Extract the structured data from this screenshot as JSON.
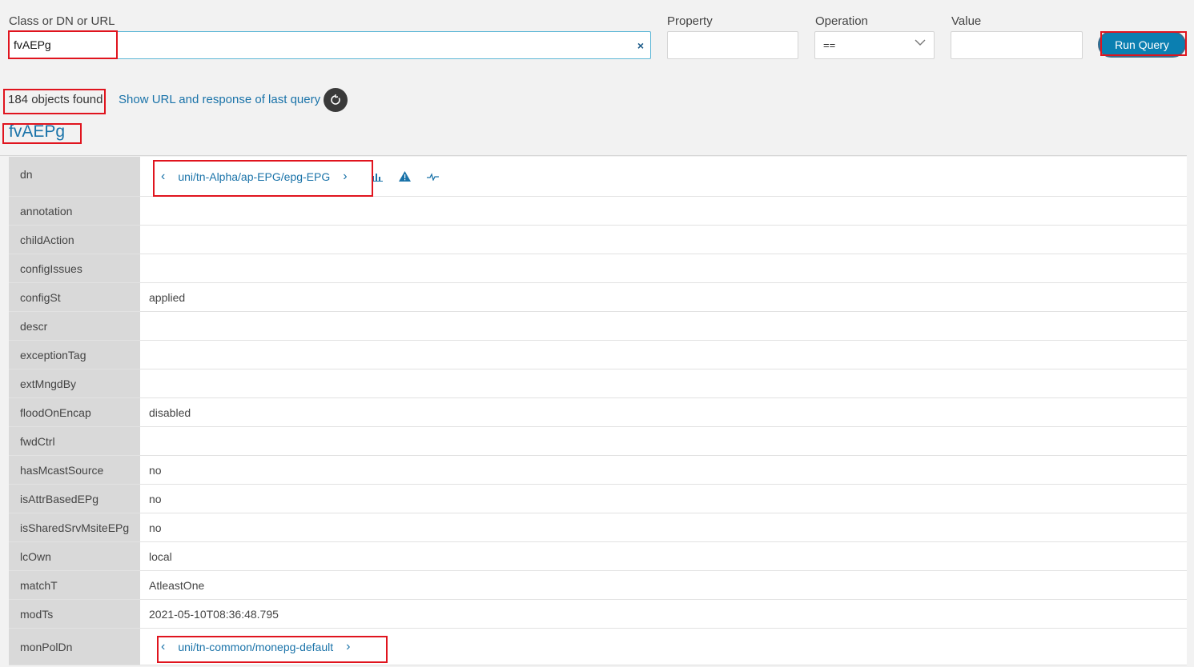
{
  "query": {
    "class_label": "Class or DN or URL",
    "class_value": "fvAEPg",
    "clear_icon": "×",
    "property_label": "Property",
    "operation_label": "Operation",
    "operation_value": "==",
    "value_label": "Value",
    "run_label": "Run Query"
  },
  "results": {
    "found_text": "184 objects found",
    "show_link": "Show URL and response of last query",
    "class_title": "fvAEPg"
  },
  "rows": [
    {
      "key": "dn",
      "value": "uni/tn-Alpha/ap-EPG/epg-EPG"
    },
    {
      "key": "annotation",
      "value": ""
    },
    {
      "key": "childAction",
      "value": ""
    },
    {
      "key": "configIssues",
      "value": ""
    },
    {
      "key": "configSt",
      "value": "applied"
    },
    {
      "key": "descr",
      "value": ""
    },
    {
      "key": "exceptionTag",
      "value": ""
    },
    {
      "key": "extMngdBy",
      "value": ""
    },
    {
      "key": "floodOnEncap",
      "value": "disabled"
    },
    {
      "key": "fwdCtrl",
      "value": ""
    },
    {
      "key": "hasMcastSource",
      "value": "no"
    },
    {
      "key": "isAttrBasedEPg",
      "value": "no"
    },
    {
      "key": "isSharedSrvMsiteEPg",
      "value": "no"
    },
    {
      "key": "lcOwn",
      "value": "local"
    },
    {
      "key": "matchT",
      "value": "AtleastOne"
    },
    {
      "key": "modTs",
      "value": "2021-05-10T08:36:48.795"
    },
    {
      "key": "monPolDn",
      "value": "uni/tn-common/monepg-default"
    }
  ],
  "icons": [
    "bar-chart-icon",
    "warning-triangle-icon",
    "pulse-icon",
    "refresh-icon",
    "chevron-left-icon",
    "chevron-right-icon",
    "chevron-down-icon"
  ],
  "colors": {
    "accent": "#1a73a9",
    "button": "#0b7fb1",
    "highlight": "#e0141e"
  }
}
